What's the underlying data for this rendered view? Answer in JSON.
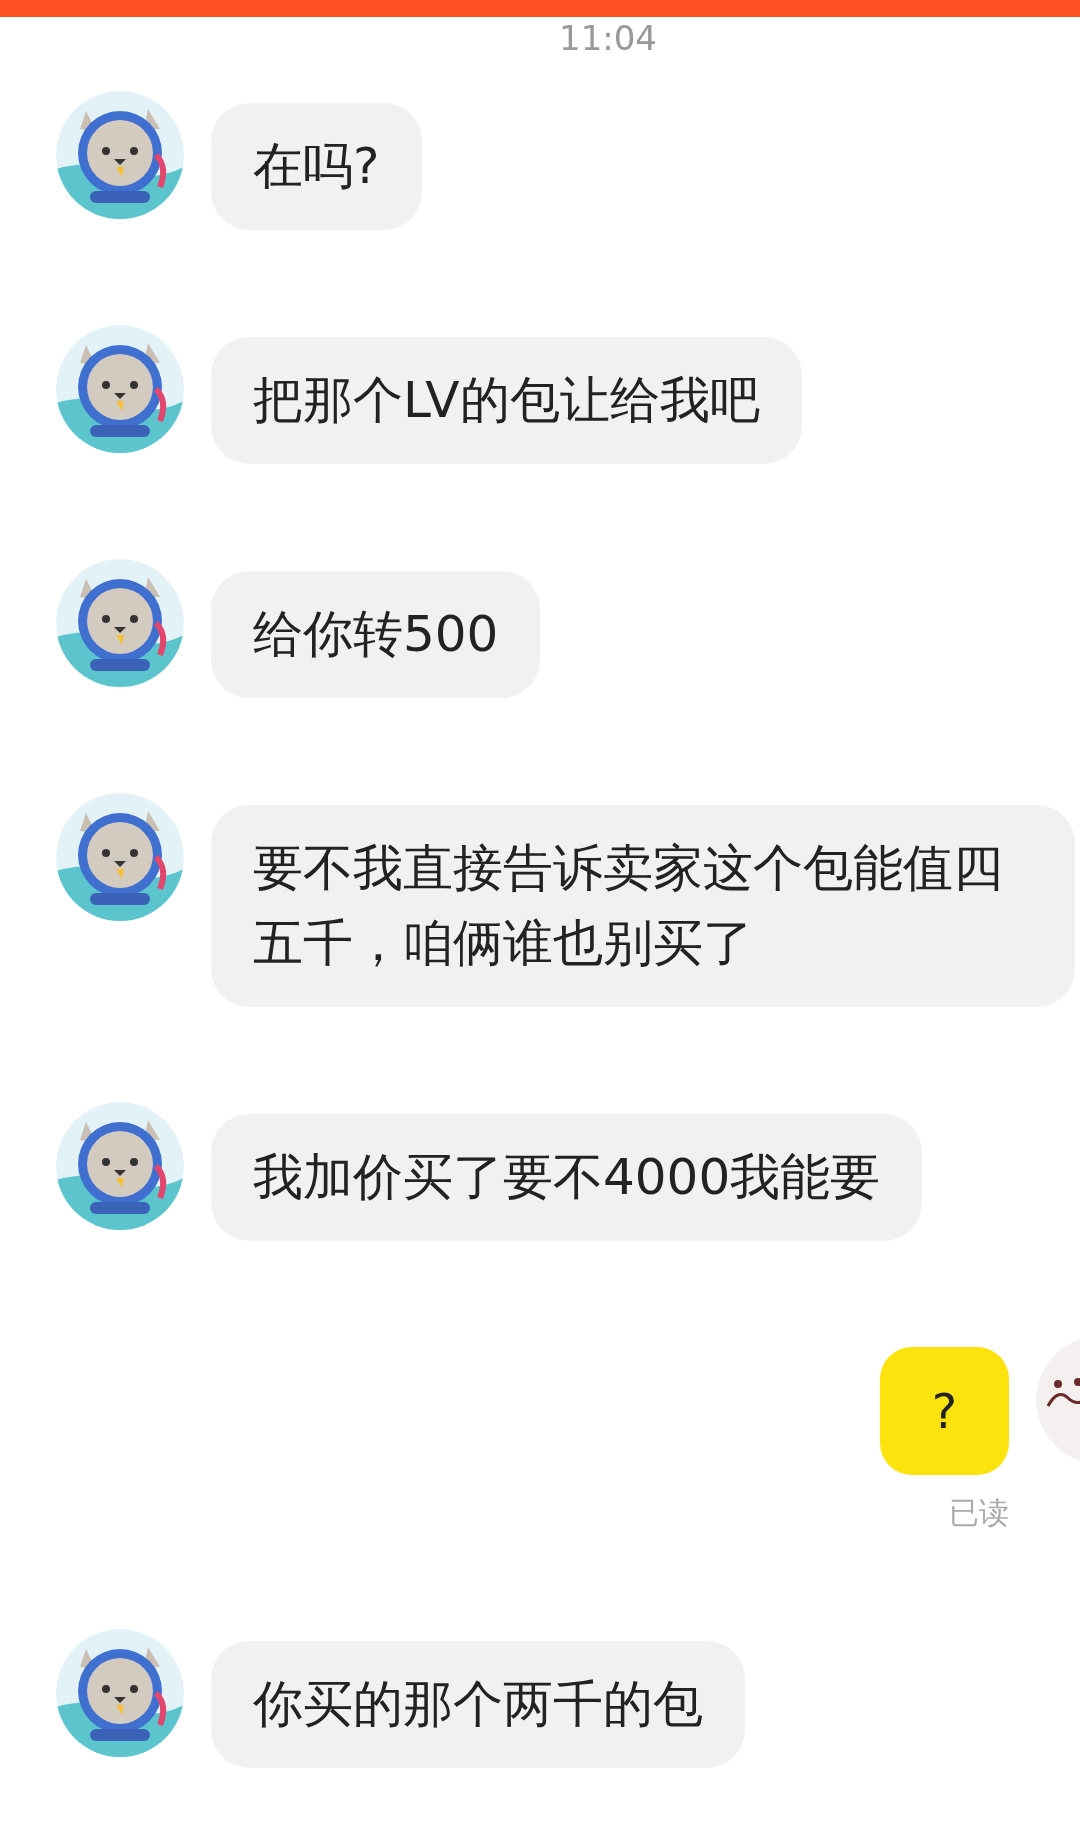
{
  "time_stamp": "11:04",
  "messages": [
    {
      "kind": "incoming",
      "text": "在吗?"
    },
    {
      "kind": "incoming",
      "text": "把那个LV的包让给我吧"
    },
    {
      "kind": "incoming",
      "text": "给你转500"
    },
    {
      "kind": "incoming",
      "text": "要不我直接告诉卖家这个包能值四五千，咱俩谁也别买了"
    },
    {
      "kind": "incoming",
      "text": "我加价买了要不4000我能要"
    },
    {
      "kind": "outgoing",
      "text": "?",
      "status": "已读"
    },
    {
      "kind": "incoming",
      "text": "你买的那个两千的包"
    }
  ]
}
